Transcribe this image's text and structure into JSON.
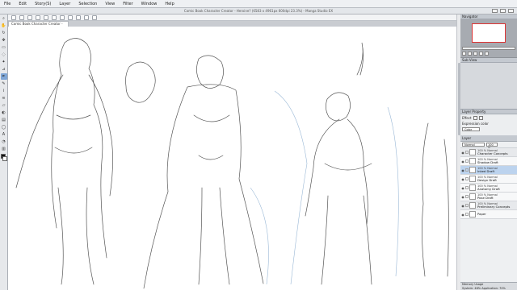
{
  "menu": [
    "File",
    "Edit",
    "Story(S)",
    "Layer",
    "Selection",
    "View",
    "Filter",
    "Window",
    "Help"
  ],
  "window": {
    "title": "Comic Book Character Creator - Heroine? (6583 x 4961px 600dpi 23.3%) - Manga Studio EX"
  },
  "document": {
    "tab_label": "Comic Book Character Creator - Heroine?"
  },
  "tools": [
    "zoom-icon",
    "hand-icon",
    "rotate-icon",
    "move-icon",
    "select-icon",
    "lasso-icon",
    "wand-icon",
    "eyedropper-icon",
    "pen-icon",
    "pencil-icon",
    "brush-icon",
    "airbrush-icon",
    "eraser-icon",
    "fill-icon",
    "gradient-icon",
    "shape-icon",
    "text-icon",
    "balloon-icon",
    "ruler-icon"
  ],
  "panels": {
    "navigator": {
      "title": "Navigator"
    },
    "subview": {
      "title": "Sub View"
    },
    "layer_property": {
      "title": "Layer Property",
      "effect_label": "Effect",
      "expression_label": "Expression color",
      "expression_value": "Color"
    },
    "layers": {
      "title": "Layer",
      "blend_mode": "Normal",
      "opacity": "100 %",
      "items": [
        {
          "pct": "100 % Normal",
          "name": "Character Concepts",
          "folder": true,
          "active": false
        },
        {
          "pct": "100 % Normal",
          "name": "Shadow Draft",
          "folder": false,
          "active": false
        },
        {
          "pct": "100 % Normal",
          "name": "Inked Draft",
          "folder": false,
          "active": true
        },
        {
          "pct": "100 % Normal",
          "name": "Design Draft",
          "folder": false,
          "active": false
        },
        {
          "pct": "100 % Normal",
          "name": "Anatomy Draft",
          "folder": false,
          "active": false
        },
        {
          "pct": "100 % Normal",
          "name": "Pose Draft",
          "folder": false,
          "active": false
        },
        {
          "pct": "100 % Normal",
          "name": "Preliminary Concepts",
          "folder": true,
          "active": false
        },
        {
          "pct": "",
          "name": "Paper",
          "folder": false,
          "active": false
        }
      ]
    }
  },
  "status": {
    "memory": "Memory Usage",
    "system": "System: 46%",
    "application": "Application: 70%"
  }
}
